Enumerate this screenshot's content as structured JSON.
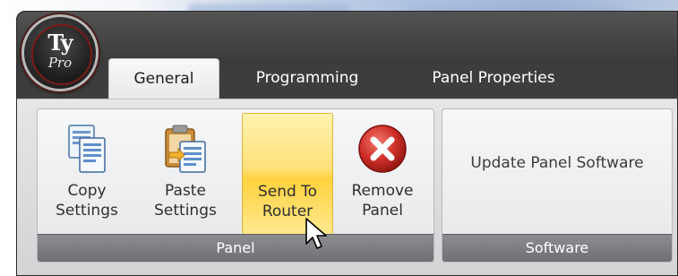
{
  "app": {
    "logo": {
      "main": "Ty",
      "sub": "Pro"
    }
  },
  "tabs": [
    {
      "label": "General",
      "active": true
    },
    {
      "label": "Programming",
      "active": false
    },
    {
      "label": "Panel Properties",
      "active": false
    }
  ],
  "groups": {
    "panel": {
      "label": "Panel",
      "buttons": {
        "copy": {
          "line1": "Copy",
          "line2": "Settings",
          "icon": "copy-documents-icon"
        },
        "paste": {
          "line1": "Paste",
          "line2": "Settings",
          "icon": "paste-clipboard-icon"
        },
        "send": {
          "line1": "Send To",
          "line2": "Router",
          "icon": "none",
          "hovered": true
        },
        "remove": {
          "line1": "Remove",
          "line2": "Panel",
          "icon": "remove-x-icon"
        }
      }
    },
    "software": {
      "label": "Software",
      "update_label": "Update Panel Software"
    }
  },
  "colors": {
    "hover_fill": "#ffd23f",
    "remove_red": "#c0201c",
    "group_label_bg": "#7a7c7f",
    "frame_dark": "#3d3d3d"
  }
}
